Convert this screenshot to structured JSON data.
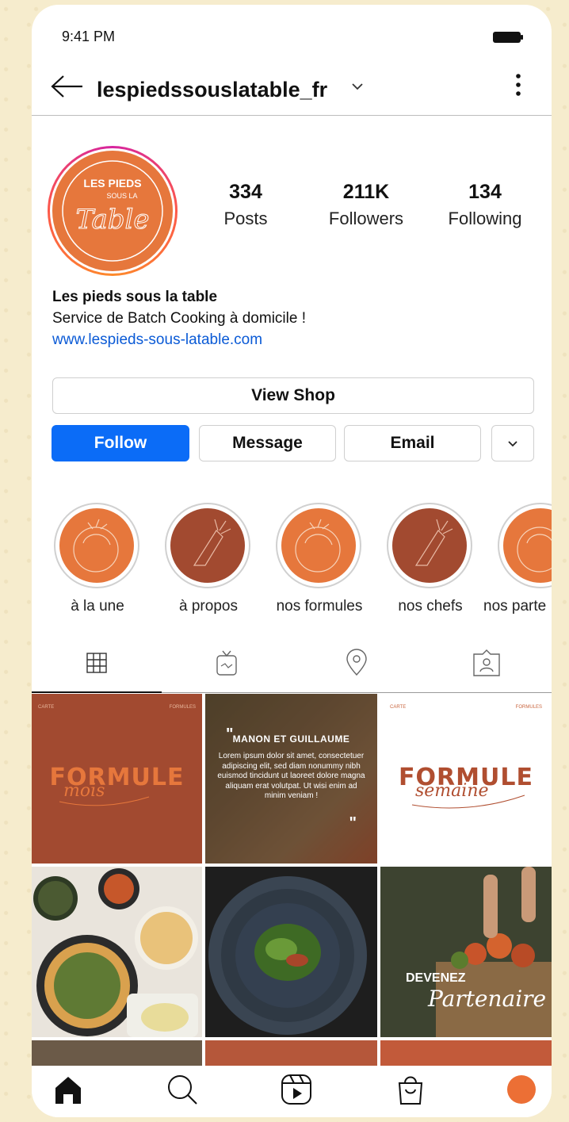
{
  "status_bar": {
    "time": "9:41 PM"
  },
  "header": {
    "username": "lespiedssouslatable_fr"
  },
  "profile": {
    "avatar_text": {
      "line1": "LES PIEDS",
      "line2": "SOUS LA",
      "line3": "Table"
    },
    "stats": [
      {
        "value": "334",
        "label": "Posts"
      },
      {
        "value": "211K",
        "label": "Followers"
      },
      {
        "value": "134",
        "label": "Following"
      }
    ],
    "name": "Les pieds sous la table",
    "description": "Service de Batch Cooking à domicile !",
    "link": "www.lespieds-sous-latable.com"
  },
  "actions": {
    "view_shop": "View Shop",
    "follow": "Follow",
    "message": "Message",
    "email": "Email"
  },
  "highlights": [
    {
      "label": "à la une",
      "icon": "tomato-icon",
      "color": "#e6773c"
    },
    {
      "label": "à propos",
      "icon": "carrot-icon",
      "color": "#a24a30"
    },
    {
      "label": "nos formules",
      "icon": "tomato-icon",
      "color": "#e6773c"
    },
    {
      "label": "nos chefs",
      "icon": "carrot-icon",
      "color": "#a24a30"
    },
    {
      "label": "nos parte",
      "icon": "tomato-icon",
      "color": "#e6773c"
    }
  ],
  "tabs": [
    "grid-icon",
    "igtv-icon",
    "location-pin-icon",
    "tagged-icon"
  ],
  "posts": {
    "p1": {
      "corner_left": "CARTE",
      "corner_right": "FORMULES",
      "title": "FORMULE",
      "script": "mois"
    },
    "p2": {
      "quote_open": "\"",
      "heading": "MANON ET GUILLAUME",
      "body": "Lorem ipsum dolor sit amet, consectetuer adipiscing elit, sed diam nonummy nibh euismod tincidunt ut laoreet dolore magna aliquam erat volutpat. Ut wisi enim ad minim veniam !",
      "quote_close": "\""
    },
    "p3": {
      "corner_left": "CARTE",
      "corner_right": "FORMULES",
      "title": "FORMULE",
      "script": "semaine"
    },
    "p6": {
      "title": "DEVENEZ",
      "script": "Partenaire"
    }
  },
  "colors": {
    "brand_orange": "#e6773c",
    "brand_brown": "#a24a30",
    "follow_blue": "#0b6cf7",
    "link_blue": "#0a5ad6"
  },
  "bottom_nav": [
    "home-icon",
    "search-icon",
    "reels-icon",
    "shop-icon",
    "profile-avatar"
  ]
}
